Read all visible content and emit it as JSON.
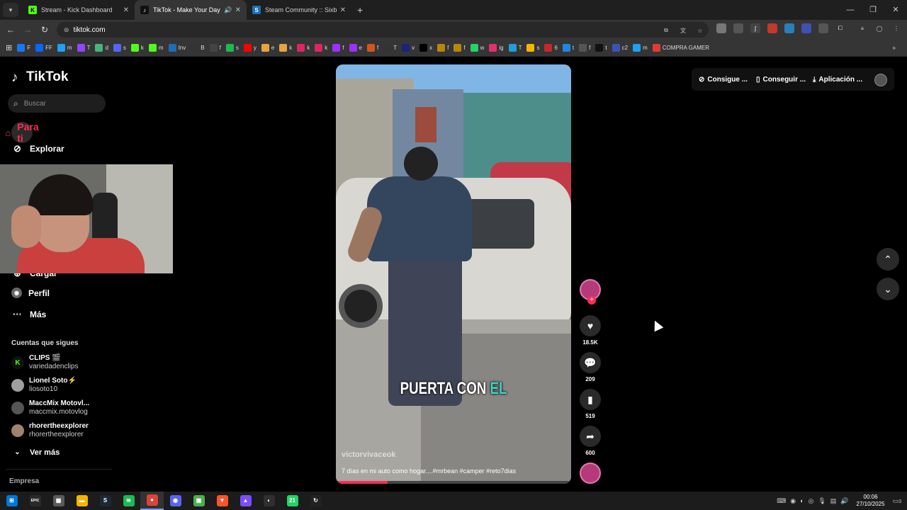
{
  "browser": {
    "tabs": [
      {
        "title": "Stream - Kick Dashboard",
        "favicon": "kick-icon",
        "color": "#53fc18",
        "glyph": "K"
      },
      {
        "title": "TikTok - Make Your Day",
        "favicon": "tiktok-icon",
        "color": "#111111",
        "glyph": "♪"
      },
      {
        "title": "Steam Community :: Sixbullets",
        "favicon": "steam-icon",
        "color": "#1b6fb5",
        "glyph": "S"
      }
    ],
    "new_tab": "+",
    "url": "tiktok.com",
    "bookmarks": [
      {
        "label": "F",
        "color": "#1877f2"
      },
      {
        "label": "FF",
        "color": "#0866ff"
      },
      {
        "label": "m",
        "color": "#1da1f2"
      },
      {
        "label": "T",
        "color": "#9146ff"
      },
      {
        "label": "d",
        "color": "#43b581"
      },
      {
        "label": "s",
        "color": "#5865f2"
      },
      {
        "label": "k",
        "color": "#53fc18"
      },
      {
        "label": "m",
        "color": "#53fc18"
      },
      {
        "label": "Inv",
        "color": "#1b6fb5"
      },
      {
        "label": "B",
        "color": "#333333"
      },
      {
        "label": "f",
        "color": "#444444"
      },
      {
        "label": "s",
        "color": "#1db954"
      },
      {
        "label": "y",
        "color": "#ff0000"
      },
      {
        "label": "e",
        "color": "#e8a33d"
      },
      {
        "label": "k",
        "color": "#e8a33d"
      },
      {
        "label": "k",
        "color": "#e0245e"
      },
      {
        "label": "k",
        "color": "#e0245e"
      },
      {
        "label": "f",
        "color": "#9b30ff"
      },
      {
        "label": "e",
        "color": "#9b30ff"
      },
      {
        "label": "f",
        "color": "#d4541d"
      },
      {
        "label": "T",
        "color": "#333333"
      },
      {
        "label": "v",
        "color": "#1a237e"
      },
      {
        "label": "x",
        "color": "#000000"
      },
      {
        "label": "f",
        "color": "#b8860b"
      },
      {
        "label": "f",
        "color": "#b8860b"
      },
      {
        "label": "w",
        "color": "#25d366"
      },
      {
        "label": "ig",
        "color": "#e1306c"
      },
      {
        "label": "T",
        "color": "#229ed9"
      },
      {
        "label": "s",
        "color": "#f5b700"
      },
      {
        "label": "6",
        "color": "#c62828"
      },
      {
        "label": "t",
        "color": "#1e88e5"
      },
      {
        "label": "f",
        "color": "#555555"
      },
      {
        "label": "t",
        "color": "#111111"
      },
      {
        "label": "c2",
        "color": "#3f51b5"
      },
      {
        "label": "m",
        "color": "#1da1f2"
      },
      {
        "label": "COMPRA GAMER",
        "color": "#e53935"
      }
    ]
  },
  "sidebar": {
    "brand": "TikTok",
    "search_placeholder": "Buscar",
    "nav_top": [
      {
        "label": "Para ti",
        "icon": "home-icon"
      },
      {
        "label": "Explorar",
        "icon": "compass-icon"
      }
    ],
    "nav_bottom": [
      {
        "label": "Cargar",
        "icon": "upload-icon"
      },
      {
        "label": "Perfil",
        "icon": "profile-icon"
      },
      {
        "label": "Más",
        "icon": "more-icon"
      }
    ],
    "following_title": "Cuentas que sigues",
    "accounts": [
      {
        "name": "CLIPS 🎬",
        "handle": "variedadenclips",
        "color": "#53fc18"
      },
      {
        "name": "Lionel Soto⚡",
        "handle": "liosoto10",
        "color": "#9e9e9e"
      },
      {
        "name": "MaccMix Motovl...",
        "handle": "maccmix.motovlog",
        "color": "#555555"
      },
      {
        "name": "rhorertheexplorer",
        "handle": "rhorertheexplorer",
        "color": "#a0826d"
      }
    ],
    "see_more": "Ver más",
    "footer": "Empresa"
  },
  "header": {
    "coins": "Consigue ...",
    "get_app": "Conseguir ...",
    "app": "Aplicación ..."
  },
  "video": {
    "caption_main": "PUERTA CON",
    "caption_accent": "EL",
    "username": "victorvivaceok",
    "description": "7 días en mi auto como hogar....#mrbean #camper #reto7dias",
    "progress": 0.22
  },
  "actions": {
    "likes": "18.5K",
    "comments": "209",
    "saves": "519",
    "shares": "600"
  },
  "taskbar": {
    "apps": [
      {
        "name": "windows-start",
        "color": "#0078d4",
        "glyph": "⊞"
      },
      {
        "name": "epic-games",
        "color": "#2a2a2a",
        "glyph": "EPIC"
      },
      {
        "name": "calculator",
        "color": "#5a5a5a",
        "glyph": "▦"
      },
      {
        "name": "file-explorer",
        "color": "#f4b400",
        "glyph": "▬"
      },
      {
        "name": "steam",
        "color": "#1b2838",
        "glyph": "S"
      },
      {
        "name": "spotify",
        "color": "#1db954",
        "glyph": "≋"
      },
      {
        "name": "chrome",
        "color": "#db4437",
        "glyph": "●"
      },
      {
        "name": "discord",
        "color": "#5865f2",
        "glyph": "◉"
      },
      {
        "name": "minecraft",
        "color": "#4caf50",
        "glyph": "▣"
      },
      {
        "name": "brave",
        "color": "#fb542b",
        "glyph": "▼"
      },
      {
        "name": "stream-app",
        "color": "#7c4dff",
        "glyph": "▲"
      },
      {
        "name": "obs",
        "color": "#302e31",
        "glyph": "◐"
      },
      {
        "name": "whatsapp",
        "color": "#25d366",
        "glyph": "21"
      },
      {
        "name": "kick-app",
        "color": "#222222",
        "glyph": "↻"
      }
    ],
    "time": "00:06",
    "date": "27/10/2025",
    "notif_count": "3"
  }
}
